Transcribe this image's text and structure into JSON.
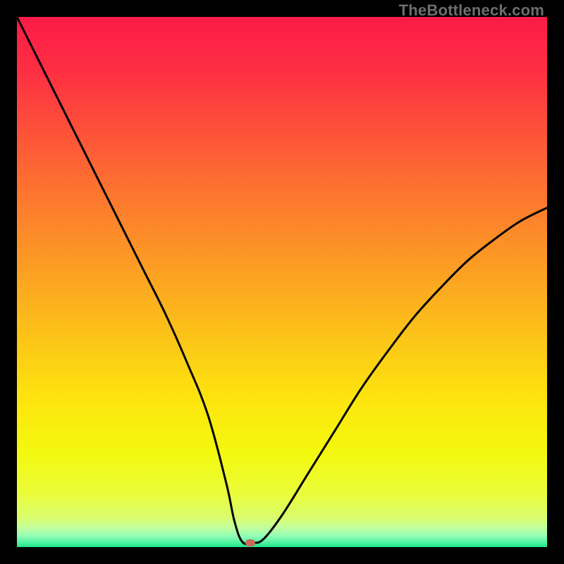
{
  "watermark": "TheBottleneck.com",
  "chart_data": {
    "type": "line",
    "title": "",
    "xlabel": "",
    "ylabel": "",
    "xlim": [
      0,
      100
    ],
    "ylim": [
      0,
      100
    ],
    "x": [
      0,
      2,
      4,
      8,
      12,
      16,
      20,
      24,
      28,
      32,
      36,
      39.5,
      41,
      42.5,
      44.5,
      46.5,
      50,
      55,
      60,
      65,
      70,
      75,
      80,
      85,
      90,
      95,
      100
    ],
    "values": [
      100,
      96,
      92,
      84,
      76,
      68,
      60,
      52,
      44,
      35,
      25,
      12,
      5,
      1,
      0.8,
      1.5,
      6,
      14,
      22,
      30,
      37,
      43.5,
      49,
      54,
      58,
      61.5,
      64
    ],
    "marker": {
      "x": 44,
      "y": 0.8,
      "color": "#c86a5a"
    },
    "gradient_stops": [
      {
        "pos": 0.0,
        "color": "#fd1b47"
      },
      {
        "pos": 0.1,
        "color": "#fd2e43"
      },
      {
        "pos": 0.22,
        "color": "#fd5339"
      },
      {
        "pos": 0.35,
        "color": "#fd7a2e"
      },
      {
        "pos": 0.48,
        "color": "#fca023"
      },
      {
        "pos": 0.6,
        "color": "#fcc318"
      },
      {
        "pos": 0.72,
        "color": "#fde40e"
      },
      {
        "pos": 0.82,
        "color": "#f4f80e"
      },
      {
        "pos": 0.9,
        "color": "#e9fd3a"
      },
      {
        "pos": 0.945,
        "color": "#d9fd6e"
      },
      {
        "pos": 0.965,
        "color": "#bffea0"
      },
      {
        "pos": 0.98,
        "color": "#8efdb7"
      },
      {
        "pos": 0.992,
        "color": "#4bf4a1"
      },
      {
        "pos": 1.0,
        "color": "#1de387"
      }
    ],
    "curve_stroke": "#000000",
    "curve_width": 3
  }
}
